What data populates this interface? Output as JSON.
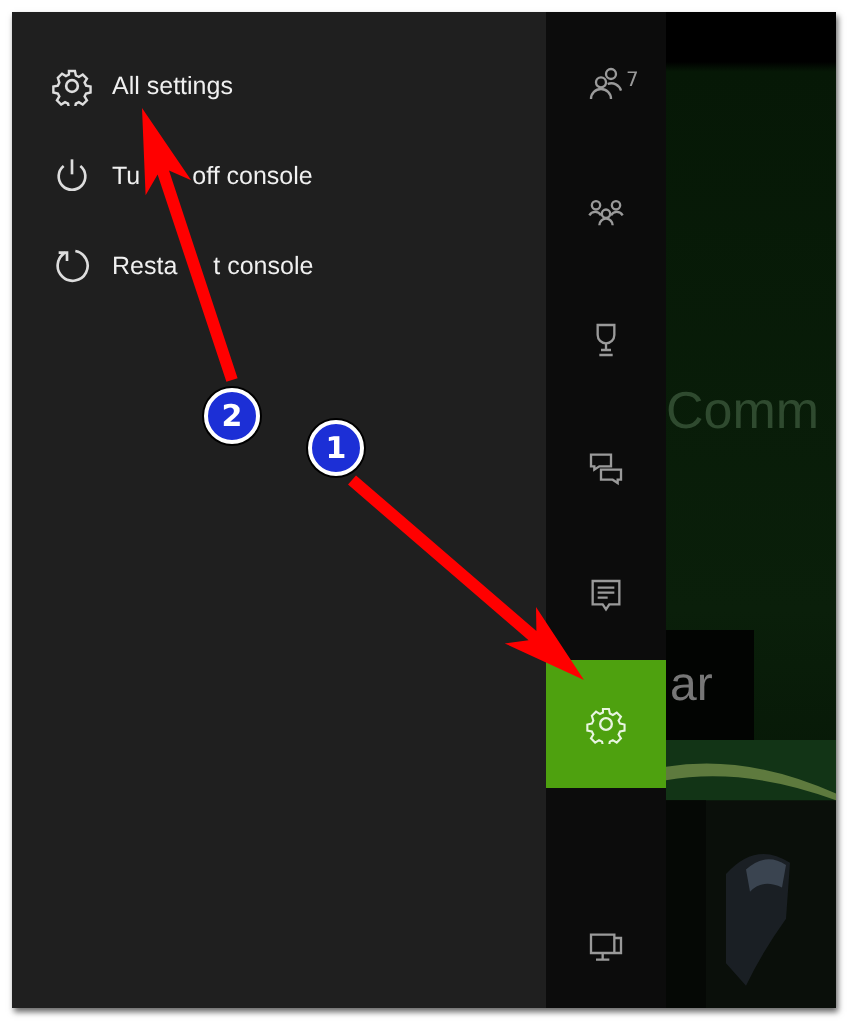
{
  "menu": {
    "items": [
      {
        "kind": "gear",
        "label": "All settings"
      },
      {
        "kind": "power",
        "label_parts": [
          "Tu",
          "off console"
        ]
      },
      {
        "kind": "restart",
        "label_parts": [
          "Resta",
          "t console"
        ]
      }
    ]
  },
  "rail": {
    "items": [
      {
        "kind": "friends",
        "count": "7",
        "selected": false
      },
      {
        "kind": "party",
        "selected": false
      },
      {
        "kind": "trophy",
        "selected": false
      },
      {
        "kind": "chat",
        "selected": false
      },
      {
        "kind": "message",
        "selected": false
      },
      {
        "kind": "gear",
        "selected": true
      },
      {
        "kind": "monitor",
        "selected": false
      }
    ]
  },
  "content": {
    "heading": "Comm",
    "tile_label": "ar"
  },
  "annotations": [
    {
      "number": "1"
    },
    {
      "number": "2"
    }
  ]
}
